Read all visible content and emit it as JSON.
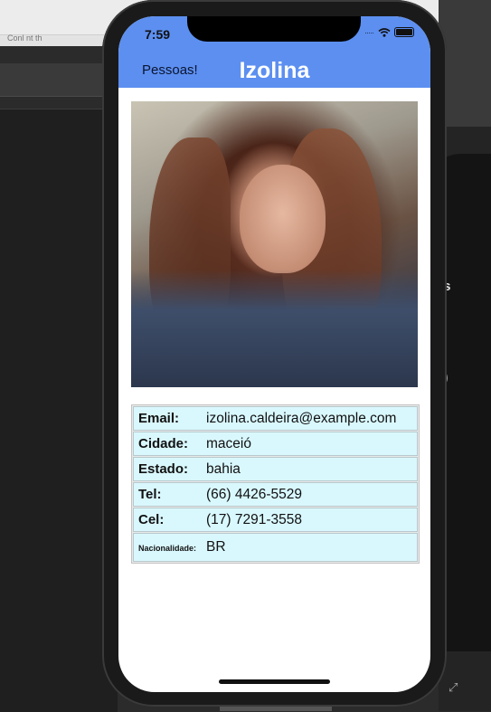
{
  "background": {
    "tab_label": "Conl nt th",
    "right_text": "ls"
  },
  "status_bar": {
    "time": "7:59",
    "signal_icon": "signal-dots-icon",
    "wifi_icon": "wifi-icon",
    "battery_icon": "battery-icon"
  },
  "nav": {
    "back_label": "Pessoas!",
    "title": "Izolina",
    "color": "#5c8ff0"
  },
  "person": {
    "photo": "profile-photo",
    "fields": [
      {
        "label": "Email:",
        "value": "izolina.caldeira@example.com"
      },
      {
        "label": "Cidade:",
        "value": "maceió"
      },
      {
        "label": "Estado:",
        "value": "bahia"
      },
      {
        "label": "Tel:",
        "value": "(66) 4426-5529"
      },
      {
        "label": "Cel:",
        "value": "(17) 7291-3558"
      },
      {
        "label": "Nacionalidade:",
        "value": "BR"
      }
    ],
    "row_color": "#d9f8fe"
  }
}
